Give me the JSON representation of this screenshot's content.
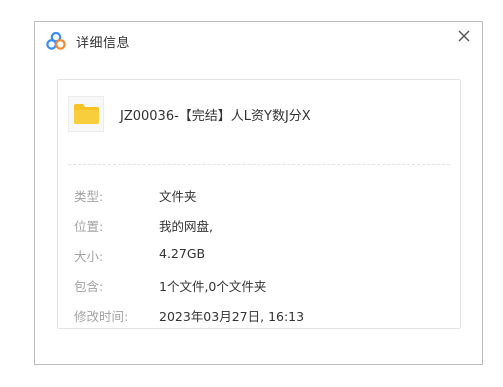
{
  "dialog": {
    "title": "详细信息",
    "app_icon": "baidu-netdisk-logo-icon",
    "close_icon": "close-icon"
  },
  "file": {
    "icon": "folder-icon",
    "icon_color": "#f7c325",
    "name": "JZ00036-【完结】人L资Y数J分X"
  },
  "details": [
    {
      "label": "类型:",
      "value": "文件夹"
    },
    {
      "label": "位置:",
      "value": "我的网盘,"
    },
    {
      "label": "大小:",
      "value": "4.27GB"
    },
    {
      "label": "包含:",
      "value": "1个文件,0个文件夹"
    },
    {
      "label": "修改时间:",
      "value": "2023年03月27日, 16:13"
    }
  ],
  "colors": {
    "label_gray": "#a3a3a3",
    "text_dark": "#333333",
    "logo_blue": "#3a8ef6",
    "logo_orange": "#f28a34"
  }
}
